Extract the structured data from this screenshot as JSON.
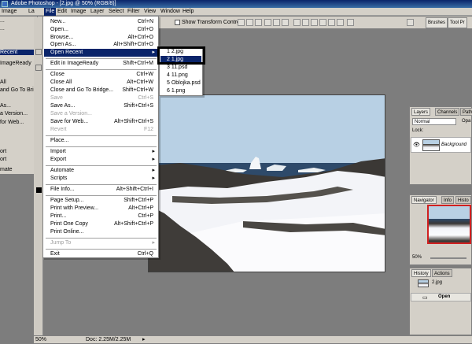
{
  "app": {
    "title": "Adobe Photoshop - [2.jpg @ 50% (RGB/8)]",
    "accent": "#0a246a"
  },
  "menubar": {
    "items": [
      "File",
      "Edit",
      "Image",
      "Layer",
      "Select",
      "Filter",
      "View",
      "Window",
      "Help"
    ]
  },
  "under_menubar": {
    "items": [
      "Image",
      "La"
    ]
  },
  "options_bar": {
    "show_transform_label": "Show Transform Controls"
  },
  "right_well_tabs": [
    "Brushes",
    "Tool Pr"
  ],
  "behind_menu": {
    "items": [
      "...",
      "...",
      "Recent",
      "ImageReady",
      "All",
      "and Go To Bridg",
      "As...",
      "a Version...",
      "for Web...",
      "ort",
      "ort",
      "mate"
    ]
  },
  "file_menu": {
    "items": [
      {
        "label": "New...",
        "shortcut": "Ctrl+N"
      },
      {
        "label": "Open...",
        "shortcut": "Ctrl+O"
      },
      {
        "label": "Browse...",
        "shortcut": "Alt+Ctrl+O"
      },
      {
        "label": "Open As...",
        "shortcut": "Alt+Shift+Ctrl+O"
      },
      {
        "label": "Open Recent",
        "shortcut": ""
      },
      {
        "label": "Edit in ImageReady",
        "shortcut": "Shift+Ctrl+M"
      },
      {
        "label": "Close",
        "shortcut": "Ctrl+W"
      },
      {
        "label": "Close All",
        "shortcut": "Alt+Ctrl+W"
      },
      {
        "label": "Close and Go To Bridge...",
        "shortcut": "Shift+Ctrl+W"
      },
      {
        "label": "Save",
        "shortcut": "Ctrl+S"
      },
      {
        "label": "Save As...",
        "shortcut": "Shift+Ctrl+S"
      },
      {
        "label": "Save a Version...",
        "shortcut": ""
      },
      {
        "label": "Save for Web...",
        "shortcut": "Alt+Shift+Ctrl+S"
      },
      {
        "label": "Revert",
        "shortcut": "F12"
      },
      {
        "label": "Place...",
        "shortcut": ""
      },
      {
        "label": "Import",
        "shortcut": ""
      },
      {
        "label": "Export",
        "shortcut": ""
      },
      {
        "label": "Automate",
        "shortcut": ""
      },
      {
        "label": "Scripts",
        "shortcut": ""
      },
      {
        "label": "File Info...",
        "shortcut": "Alt+Shift+Ctrl+I"
      },
      {
        "label": "Page Setup...",
        "shortcut": "Shift+Ctrl+P"
      },
      {
        "label": "Print with Preview...",
        "shortcut": "Alt+Ctrl+P"
      },
      {
        "label": "Print...",
        "shortcut": "Ctrl+P"
      },
      {
        "label": "Print One Copy",
        "shortcut": "Alt+Shift+Ctrl+P"
      },
      {
        "label": "Print Online...",
        "shortcut": ""
      },
      {
        "label": "Jump To",
        "shortcut": ""
      },
      {
        "label": "Exit",
        "shortcut": "Ctrl+Q"
      }
    ]
  },
  "open_recent": {
    "items": [
      "1 2.jpg",
      "2 1.jpg",
      "3 11.psd",
      "4 11.png",
      "5 Oblojka.psd",
      "6 1.png"
    ]
  },
  "status_bar": {
    "zoom": "50%",
    "doc": "Doc: 2.25M/2.25M"
  },
  "layers_panel": {
    "tabs": [
      "Layers",
      "Channels",
      "Paths"
    ],
    "blend_mode": "Normal",
    "opacity_label": "Opa",
    "lock_label": "Lock:",
    "layer_name": "Background"
  },
  "navigator_panel": {
    "tabs": [
      "Navigator",
      "Info",
      "Histo"
    ],
    "zoom": "50%"
  },
  "history_panel": {
    "tabs": [
      "History",
      "Actions"
    ],
    "snapshot": "2.jpg",
    "step": "Open"
  }
}
